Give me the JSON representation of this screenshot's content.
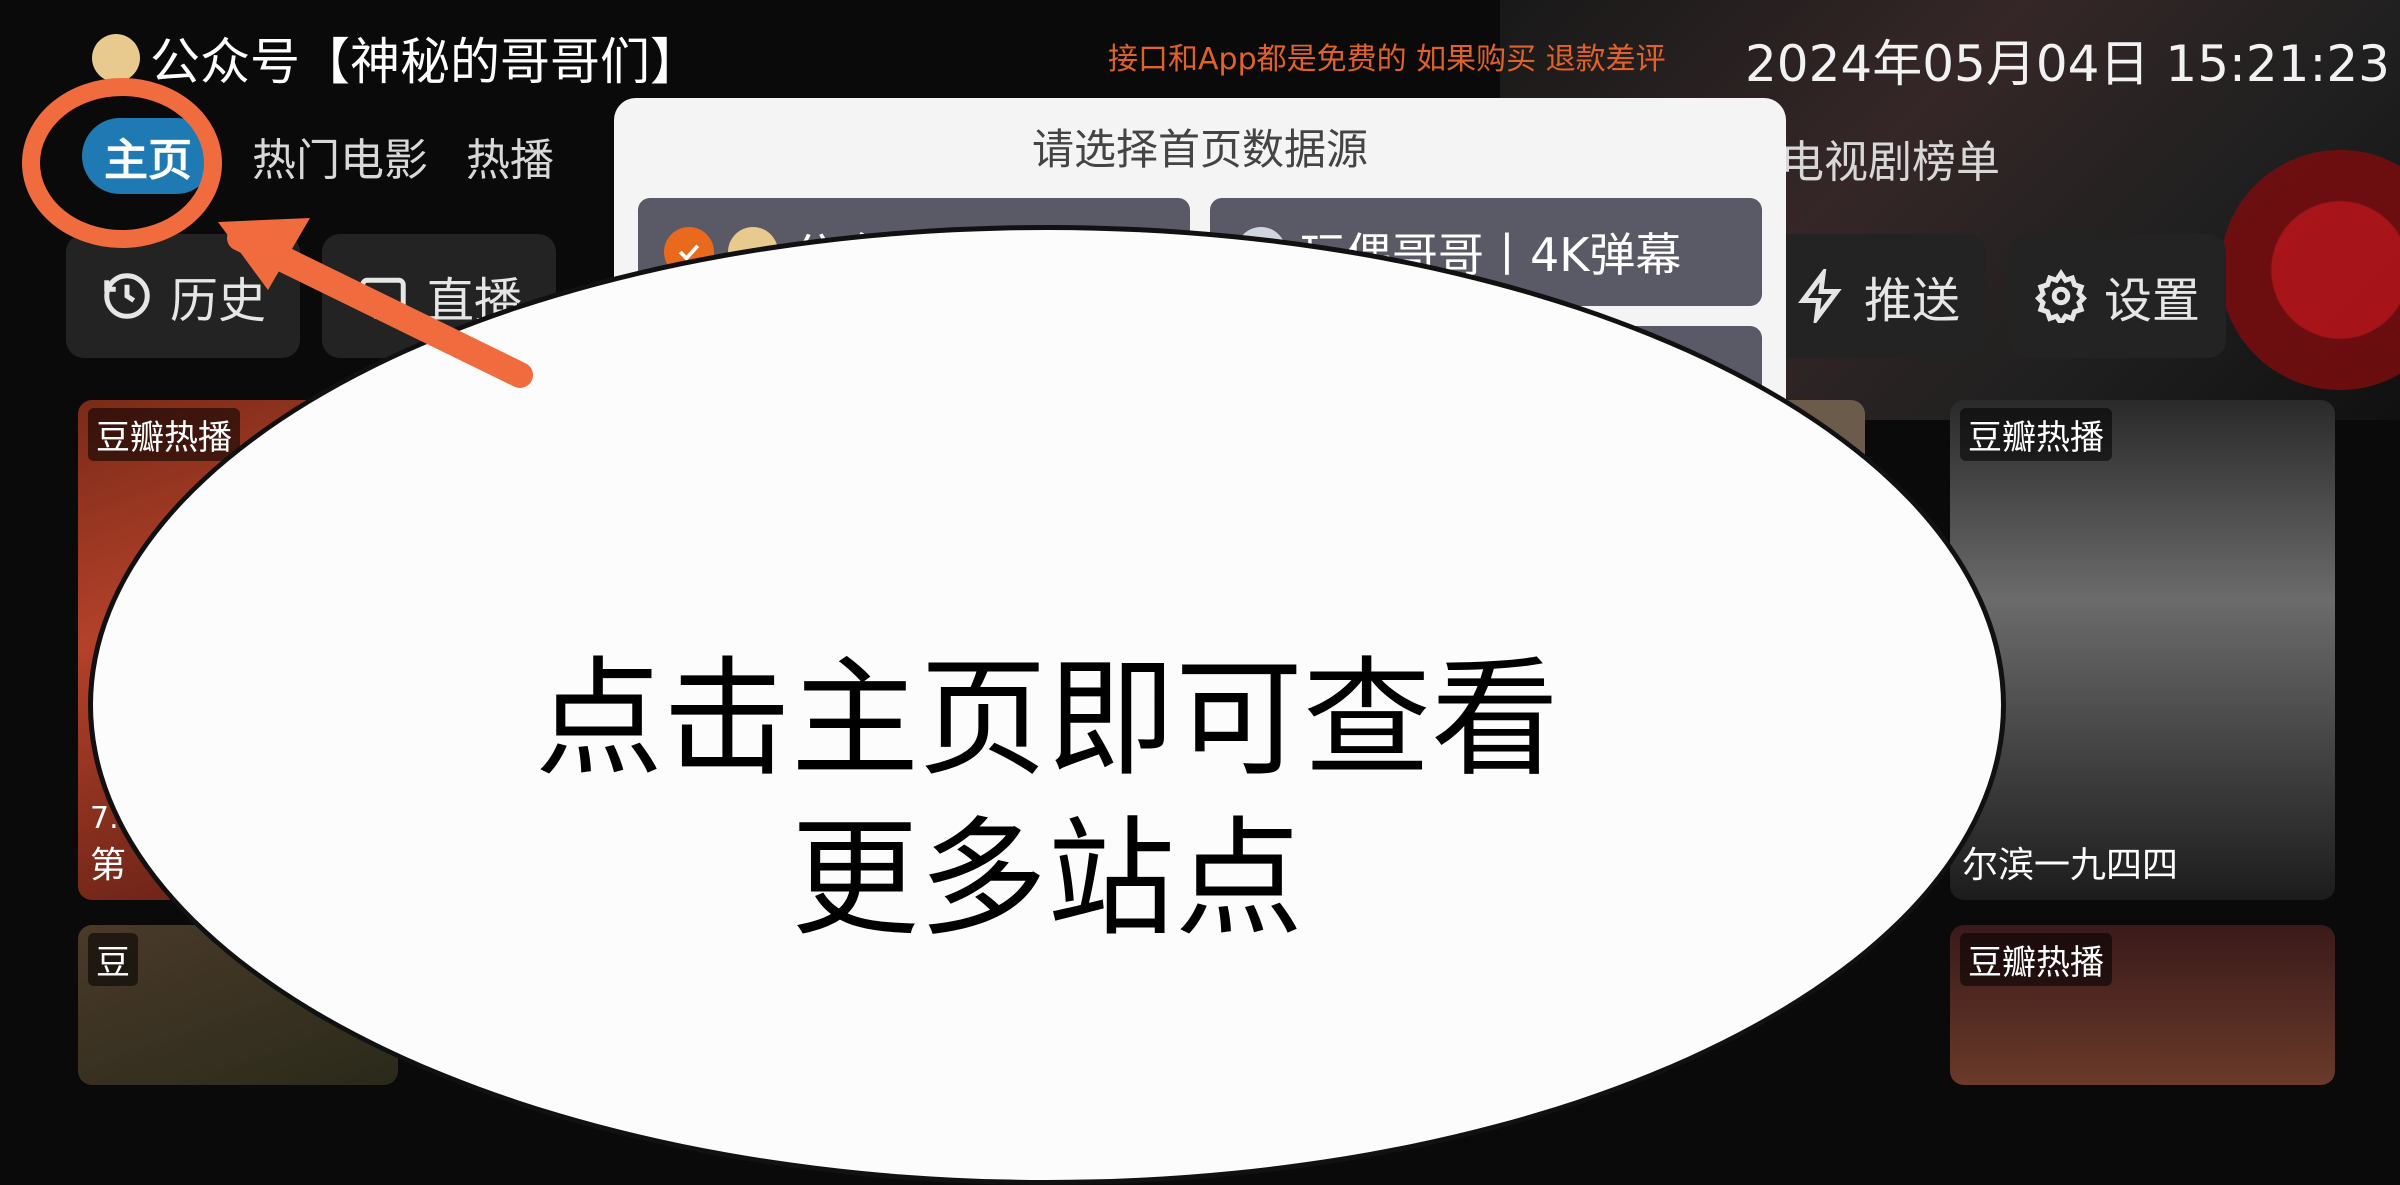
{
  "header": {
    "brand": "公众号【神秘的哥哥们】",
    "notice": "接口和App都是免费的 如果购买 退款差评",
    "datetime": "2024年05月04日 15:21:23"
  },
  "tabs": {
    "active": "主页",
    "items": [
      "热门电影",
      "热播"
    ],
    "right": "电视剧榜单"
  },
  "toolbar": {
    "history": "历史",
    "live": "直播",
    "push": "推送",
    "settings": "设置"
  },
  "dialog": {
    "title": "请选择首页数据源",
    "option_1": "公众",
    "option_2": "玩偶哥哥丨4K弹幕"
  },
  "cards": [
    {
      "badge": "豆瓣热播",
      "title": "第",
      "rating": "7."
    },
    {
      "badge": "豆瓣热播",
      "title": "尔滨一九四四"
    },
    {
      "badge": "豆"
    },
    {
      "badge": "豆瓣热播"
    }
  ],
  "overlay": {
    "line1": "点击主页即可查看",
    "line2": "更多站点"
  },
  "colors": {
    "accent": "#1f7ab3",
    "annotation": "#f06b3e",
    "notice": "#e0622a"
  }
}
